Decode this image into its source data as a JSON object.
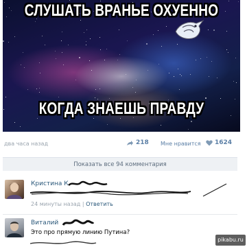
{
  "meme": {
    "top_text": "СЛУШАТЬ ВРАНЬЕ ОХУЕННО",
    "bottom_text": "КОГДА ЗНАЕШЬ ПРАВДУ"
  },
  "post_meta": {
    "time": "два часа назад",
    "reposts": "218",
    "likes_label": "Мне нравится",
    "likes": "1624"
  },
  "show_all_comments": "Показать все 94 комментария",
  "comments": [
    {
      "author": "Кристина К",
      "text": "",
      "time": "24 минуты назад",
      "separator": "|",
      "reply": "Ответить"
    },
    {
      "author": "Виталий",
      "text": "Это про прямую линию Путина?",
      "time": "",
      "reply": ""
    }
  ],
  "watermark": "pikabu.ru",
  "colors": {
    "link": "#2b587a",
    "meta": "#9aa4ae",
    "show_all_bg": "#eef1f4"
  }
}
